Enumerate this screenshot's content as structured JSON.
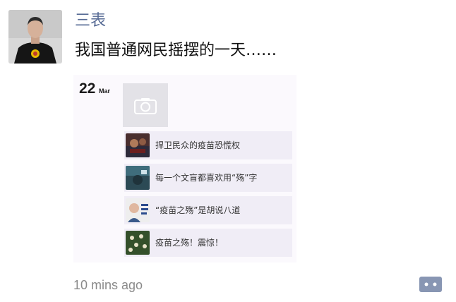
{
  "post": {
    "author": "三表",
    "text": "我国普通网民摇摆的一天……",
    "timestamp": "10 mins ago"
  },
  "shared_image": {
    "date_day": "22",
    "date_month": "Mar",
    "articles": [
      {
        "title": "捍卫民众的疫苗恐慌权",
        "thumb_color": "#5a3a3a"
      },
      {
        "title": "每一个文盲都喜欢用“殇”字",
        "thumb_color": "#3b6472"
      },
      {
        "title": "“疫苗之殇”是胡说八道",
        "thumb_color": "#e7e7e7"
      },
      {
        "title": "疫苗之殇！震惊！",
        "thumb_color": "#3e5a2e"
      }
    ]
  },
  "icons": {
    "camera": "camera-icon",
    "comment": "comment-icon"
  },
  "colors": {
    "author_link": "#576b95",
    "comment_button": "#8896b3",
    "timestamp": "#8a8a8a"
  }
}
